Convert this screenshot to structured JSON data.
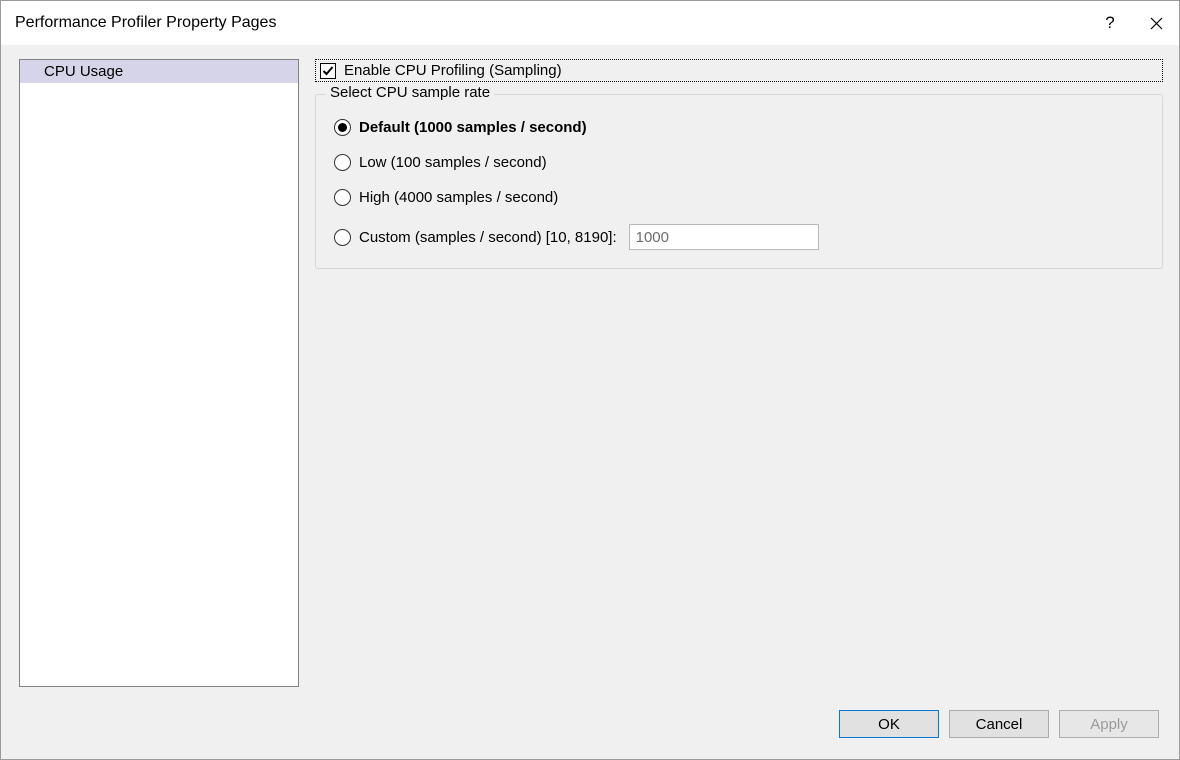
{
  "window": {
    "title": "Performance Profiler Property Pages"
  },
  "sidebar": {
    "items": [
      {
        "label": "CPU Usage"
      }
    ]
  },
  "main": {
    "enable_checkbox": {
      "label": "Enable CPU Profiling (Sampling)",
      "checked": true
    },
    "fieldset": {
      "legend": "Select CPU sample rate",
      "options": [
        {
          "label": "Default (1000 samples / second)",
          "selected": true
        },
        {
          "label": "Low (100 samples / second)",
          "selected": false
        },
        {
          "label": "High (4000 samples / second)",
          "selected": false
        },
        {
          "label": "Custom (samples / second) [10, 8190]:",
          "selected": false
        }
      ],
      "custom_value": "1000"
    }
  },
  "buttons": {
    "ok": "OK",
    "cancel": "Cancel",
    "apply": "Apply"
  }
}
